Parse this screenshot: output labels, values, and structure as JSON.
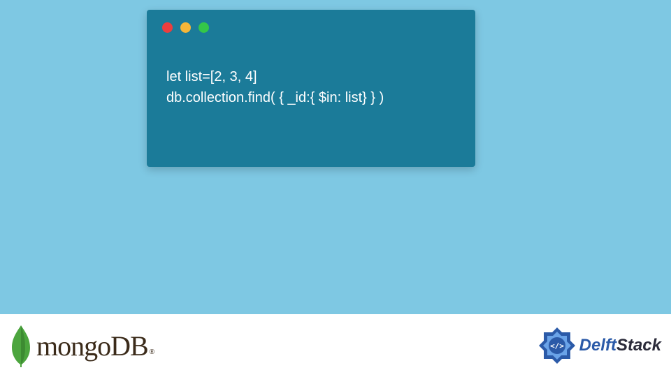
{
  "code": {
    "lines": [
      "let list=[2, 3, 4]",
      "db.collection.find( { _id:{ $in: list} } )"
    ]
  },
  "traffic_colors": {
    "red": "#ec3e3e",
    "yellow": "#f5b638",
    "green": "#34c749"
  },
  "mongo": {
    "name": "mongoDB",
    "reg": "®"
  },
  "delft": {
    "part1": "Delft",
    "part2": "Stack"
  }
}
